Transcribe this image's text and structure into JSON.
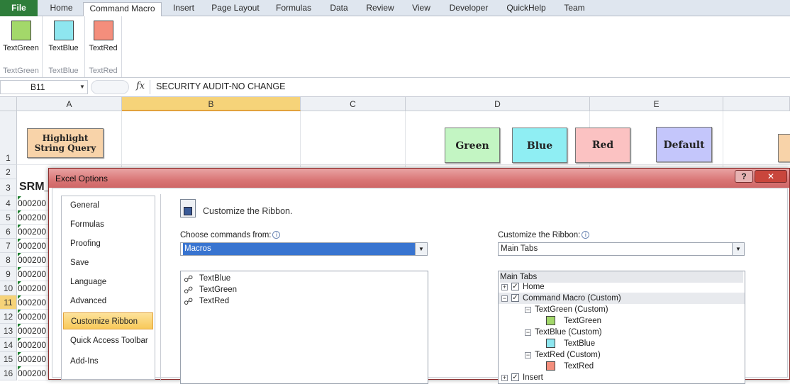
{
  "tabs": [
    "File",
    "Home",
    "Command Macro",
    "Insert",
    "Page Layout",
    "Formulas",
    "Data",
    "Review",
    "View",
    "Developer",
    "QuickHelp",
    "Team"
  ],
  "active_tab": "Command Macro",
  "ribbon": {
    "groups": [
      {
        "button": "TextGreen",
        "group": "TextGreen",
        "color": "#a3d86a"
      },
      {
        "button": "TextBlue",
        "group": "TextBlue",
        "color": "#8ee6ef"
      },
      {
        "button": "TextRed",
        "group": "TextRed",
        "color": "#f48e7c"
      }
    ]
  },
  "formula_bar": {
    "name_box": "B11",
    "fx": "fx",
    "content": "SECURITY AUDIT-NO CHANGE"
  },
  "sheet": {
    "columns": [
      "A",
      "B",
      "C",
      "D",
      "E"
    ],
    "selected_column": "B",
    "rows": [
      "1",
      "2",
      "3",
      "4",
      "5",
      "6",
      "7",
      "8",
      "9",
      "10",
      "11",
      "12",
      "13",
      "14",
      "15",
      "16"
    ],
    "selected_row": "11",
    "highlight_button": "Highlight String Query",
    "color_buttons": [
      {
        "label": "Green",
        "color": "#c3f5c3"
      },
      {
        "label": "Blue",
        "color": "#8feef3"
      },
      {
        "label": "Red",
        "color": "#fbc2c2"
      },
      {
        "label": "Default",
        "color": "#c4c6fb"
      }
    ],
    "a3": "SRM_",
    "a_values": [
      "000200",
      "000200",
      "000200",
      "000200",
      "000200",
      "000200",
      "000200",
      "000200",
      "000200",
      "000200",
      "000200",
      "000200",
      "000200"
    ]
  },
  "dialog": {
    "title": "Excel Options",
    "help_btn": "?",
    "close_btn": "✕",
    "nav": [
      "General",
      "Formulas",
      "Proofing",
      "Save",
      "Language",
      "Advanced",
      "Customize Ribbon",
      "Quick Access Toolbar",
      "Add-Ins"
    ],
    "active_nav": "Customize Ribbon",
    "heading": "Customize the Ribbon.",
    "choose_label": "Choose commands from:",
    "choose_value": "Macros",
    "customize_label": "Customize the Ribbon:",
    "customize_value": "Main Tabs",
    "macros": [
      "TextBlue",
      "TextGreen",
      "TextRed"
    ],
    "tree": {
      "header": "Main Tabs",
      "home": "Home",
      "command_macro": "Command Macro (Custom)",
      "groups": [
        {
          "group": "TextGreen (Custom)",
          "item": "TextGreen",
          "color": "#a3d86a"
        },
        {
          "group": "TextBlue (Custom)",
          "item": "TextBlue",
          "color": "#8ee6ef"
        },
        {
          "group": "TextRed (Custom)",
          "item": "TextRed",
          "color": "#f48e7c"
        }
      ],
      "insert": "Insert"
    }
  }
}
